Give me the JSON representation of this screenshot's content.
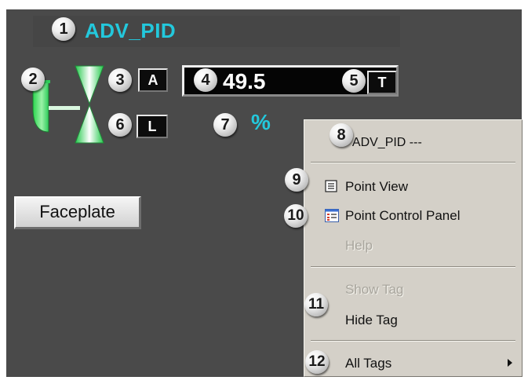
{
  "tag": {
    "name": "ADV_PID"
  },
  "mode": {
    "auto": "A",
    "local": "L",
    "trend": "T"
  },
  "pv": {
    "value": "49.5",
    "units": "%"
  },
  "faceplate": {
    "label": "Faceplate"
  },
  "context_menu": {
    "header": "- ADV_PID ---",
    "point_view": "Point View",
    "point_control_panel": "Point Control Panel",
    "help": "Help",
    "show_tag": "Show Tag",
    "hide_tag": "Hide Tag",
    "all_tags": "All Tags"
  },
  "callouts": [
    "1",
    "2",
    "3",
    "4",
    "5",
    "6",
    "7",
    "8",
    "9",
    "10",
    "11",
    "12"
  ],
  "colors": {
    "background": "#4a4a4a",
    "accent_cyan": "#23c8dc",
    "valve_green": "#2ecc5a",
    "menu": "#d4d0c8"
  }
}
